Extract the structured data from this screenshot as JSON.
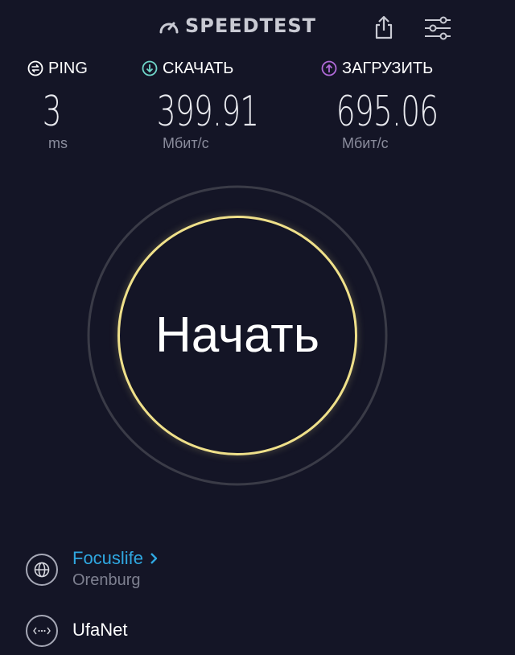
{
  "header": {
    "logo_text": "SPEEDTEST",
    "icons": {
      "share": "share-icon",
      "settings": "settings-sliders-icon",
      "logo": "speedometer-icon"
    }
  },
  "metrics": {
    "ping": {
      "label": "PING",
      "value": "3",
      "unit": "ms",
      "icon": "ping-icon"
    },
    "download": {
      "label": "СКАЧАТЬ",
      "value": "399.91",
      "unit": "Мбит/с",
      "icon": "download-arrow-icon"
    },
    "upload": {
      "label": "ЗАГРУЗИТЬ",
      "value": "695.06",
      "unit": "Мбит/с",
      "icon": "upload-arrow-icon"
    }
  },
  "start_button": {
    "label": "Начать"
  },
  "server": {
    "provider": "Focuslife",
    "location": "Orenburg",
    "connection": "UfaNet",
    "icons": {
      "provider": "globe-icon",
      "connection": "connection-icon",
      "chevron": "chevron-right-icon"
    }
  },
  "colors": {
    "background": "#141526",
    "ring_accent": "#efe08a",
    "provider_link": "#2fa7e0",
    "ping_icon": "#ffffff",
    "download_icon": "#6fd6c9",
    "upload_icon": "#b06ad8",
    "muted_text": "#8a8c9c"
  }
}
